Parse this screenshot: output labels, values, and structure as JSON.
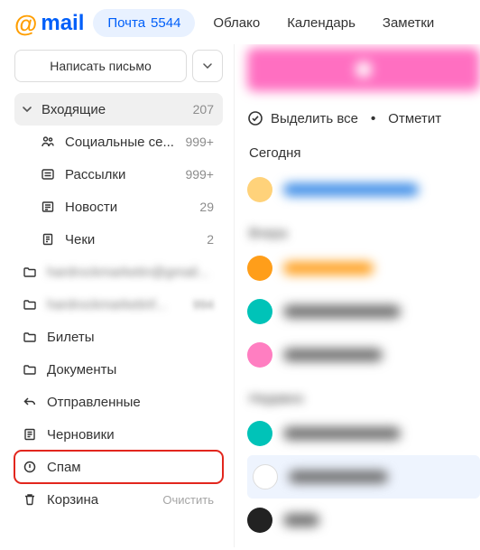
{
  "header": {
    "logo_text": "mail",
    "nav": {
      "mail_label": "Почта",
      "mail_count": "5544",
      "cloud": "Облако",
      "calendar": "Календарь",
      "notes": "Заметки"
    }
  },
  "sidebar": {
    "compose": "Написать письмо",
    "folders": [
      {
        "label": "Входящие",
        "count": "207"
      },
      {
        "label": "Социальные се...",
        "count": "999+"
      },
      {
        "label": "Рассылки",
        "count": "999+"
      },
      {
        "label": "Новости",
        "count": "29"
      },
      {
        "label": "Чеки",
        "count": "2"
      },
      {
        "label": "hardrockmarketin@gmail...",
        "count": ""
      },
      {
        "label": "hardrockmarketinf...",
        "count": "994"
      },
      {
        "label": "Билеты",
        "count": ""
      },
      {
        "label": "Документы",
        "count": ""
      },
      {
        "label": "Отправленные",
        "count": ""
      },
      {
        "label": "Черновики",
        "count": ""
      },
      {
        "label": "Спам",
        "count": ""
      },
      {
        "label": "Корзина",
        "aux": "Очистить"
      }
    ]
  },
  "content": {
    "select_all": "Выделить все",
    "mark": "Отметит",
    "today": "Сегодня",
    "vchera": "Вчера",
    "nedavno": "Недавно"
  }
}
